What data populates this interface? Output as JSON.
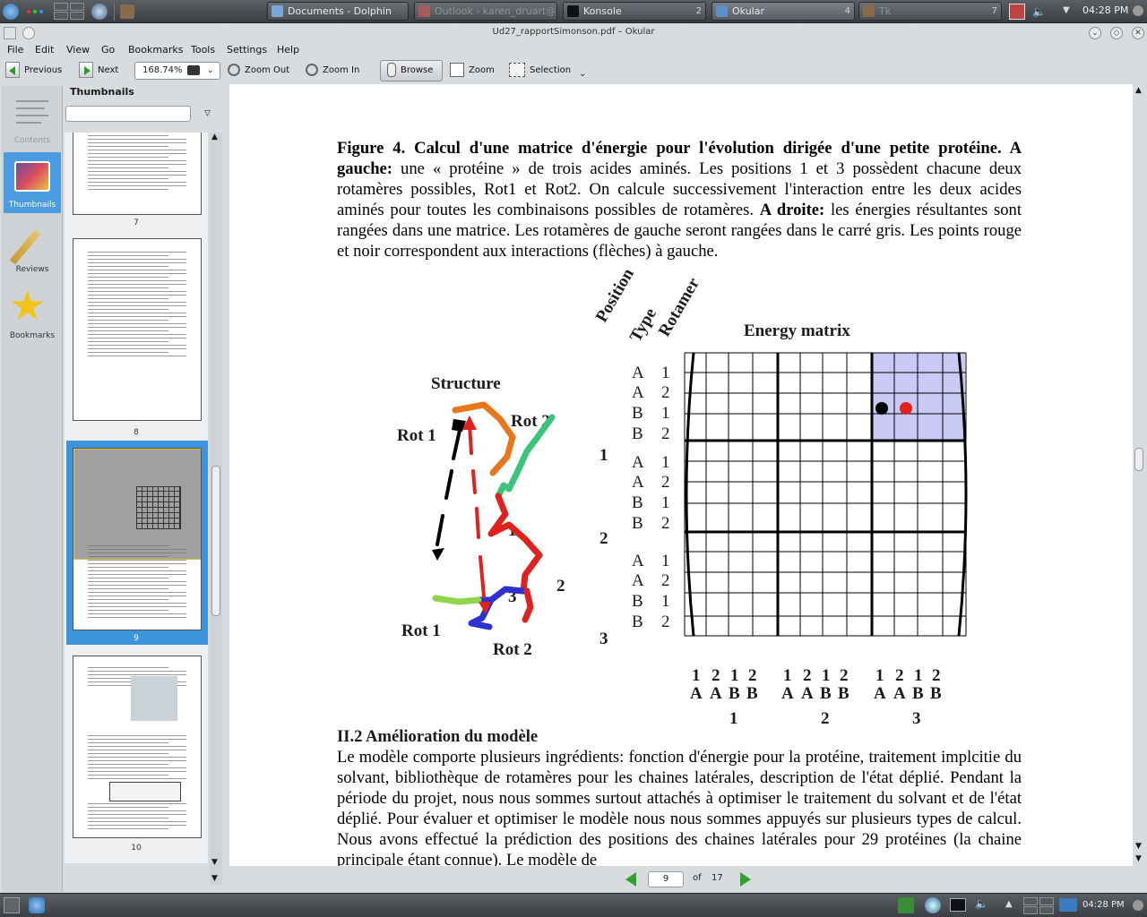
{
  "top_panel": {
    "tasks": [
      {
        "label": "Documents - Dolphin",
        "count": ""
      },
      {
        "label": "Outlook - karen_druart@...",
        "count": ""
      },
      {
        "label": "Konsole",
        "count": "2"
      },
      {
        "label": "Okular",
        "count": "4"
      },
      {
        "label": "Tk",
        "count": "7"
      }
    ],
    "clock": "04:28 PM"
  },
  "window": {
    "title": "Ud27_rapportSimonson.pdf – Okular"
  },
  "menu": [
    "File",
    "Edit",
    "View",
    "Go",
    "Bookmarks",
    "Tools",
    "Settings",
    "Help"
  ],
  "toolbar": {
    "previous": "Previous",
    "next": "Next",
    "zoom_value": "168.74%",
    "zoom_out": "Zoom Out",
    "zoom_in": "Zoom In",
    "browse": "Browse",
    "zoom": "Zoom",
    "selection": "Selection"
  },
  "sidenav": {
    "contents": "Contents",
    "thumbnails": "Thumbnails",
    "reviews": "Reviews",
    "bookmarks": "Bookmarks"
  },
  "thumbnails": {
    "title": "Thumbnails",
    "pages": [
      "7",
      "8",
      "9",
      "10"
    ]
  },
  "document": {
    "caption_bold_1": "Figure 4. Calcul d'une matrice d'énergie pour l'évolution dirigée d'une petite protéine. A gauche:",
    "caption_text_1": " une « protéine » de trois acides aminés. Les positions 1 et 3 possèdent chacune deux rotamères possibles, Rot1 et Rot2. On calcule successivement l'interaction entre les deux acides aminés pour toutes les combinaisons possibles de rotamères. ",
    "caption_bold_2": "A droite:",
    "caption_text_2": " les énergies résultantes sont rangées dans une matrice. Les rotamères de gauche seront rangées dans le carré gris. Les points rouge et noir correspondent aux interactions (flèches) à gauche.",
    "figure": {
      "structure_title": "Structure",
      "rot1_top": "Rot 1",
      "rot2_top": "Rot 2",
      "rot1_bottom": "Rot 1",
      "rot2_bottom": "Rot 2",
      "res1": "1",
      "res2": "2",
      "res3": "3",
      "header_position": "Position",
      "header_type": "Type",
      "header_rotamer": "Rotamer",
      "matrix_title": "Energy matrix",
      "row_types": [
        "A",
        "A",
        "B",
        "B",
        "A",
        "A",
        "B",
        "B",
        "A",
        "A",
        "B",
        "B"
      ],
      "row_rotamers": [
        "1",
        "2",
        "1",
        "2",
        "1",
        "2",
        "1",
        "2",
        "1",
        "2",
        "1",
        "2"
      ],
      "row_positions": [
        "1",
        "2",
        "3"
      ],
      "col_rotamers": [
        "1",
        "2",
        "1",
        "2",
        "1",
        "2",
        "1",
        "2",
        "1",
        "2",
        "1",
        "2"
      ],
      "col_types": [
        "A",
        "A",
        "B",
        "B",
        "A",
        "A",
        "B",
        "B",
        "A",
        "A",
        "B",
        "B"
      ],
      "col_positions": [
        "1",
        "2",
        "3"
      ]
    },
    "section_title": "II.2 Amélioration du modèle",
    "section_text": "Le modèle comporte plusieurs ingrédients: fonction d'énergie pour la protéine, traitement implcitie du solvant, bibliothèque de rotamères pour les chaines latérales, description de l'état déplié. Pendant la période du projet, nous nous sommes surtout attachés à optimiser le traitement du solvant et de l'état déplié. Pour évaluer et optimiser le modèle nous nous sommes appuyés sur plusieurs types de calcul. Nous avons effectué la prédiction des positions des chaines latérales pour 29 protéines (la chaine principale étant connue). Le modèle de"
  },
  "pagenav": {
    "current": "9",
    "of_label": "of",
    "total": "17"
  },
  "bottom_panel": {
    "clock": "04:28 PM"
  }
}
